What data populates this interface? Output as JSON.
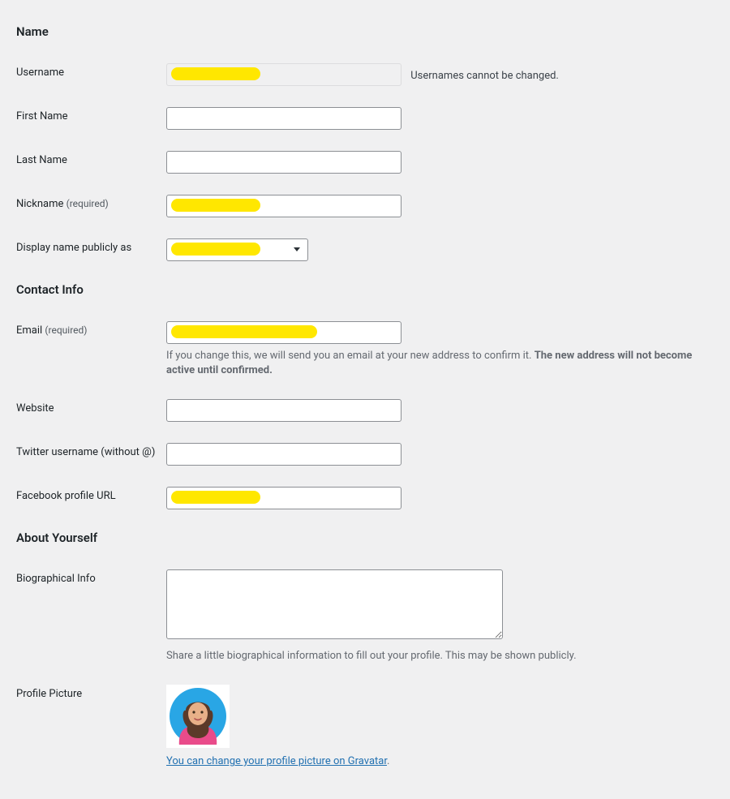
{
  "sections": {
    "name": "Name",
    "contact": "Contact Info",
    "about": "About Yourself"
  },
  "labels": {
    "username": "Username",
    "first_name": "First Name",
    "last_name": "Last Name",
    "nickname": "Nickname",
    "nickname_req": "(required)",
    "display_name": "Display name publicly as",
    "email": "Email",
    "email_req": "(required)",
    "website": "Website",
    "twitter": "Twitter username (without @)",
    "facebook": "Facebook profile URL",
    "bio": "Biographical Info",
    "profile_pic": "Profile Picture"
  },
  "values": {
    "username": "",
    "first_name": "",
    "last_name": "",
    "nickname": "",
    "display_name": "",
    "email": "",
    "website": "",
    "twitter": "",
    "facebook": "",
    "bio": ""
  },
  "help": {
    "username_note": "Usernames cannot be changed.",
    "email_note_a": "If you change this, we will send you an email at your new address to confirm it. ",
    "email_note_b": "The new address will not become active until confirmed.",
    "bio_desc": "Share a little biographical information to fill out your profile. This may be shown publicly.",
    "gravatar_link": "You can change your profile picture on Gravatar",
    "period": "."
  }
}
